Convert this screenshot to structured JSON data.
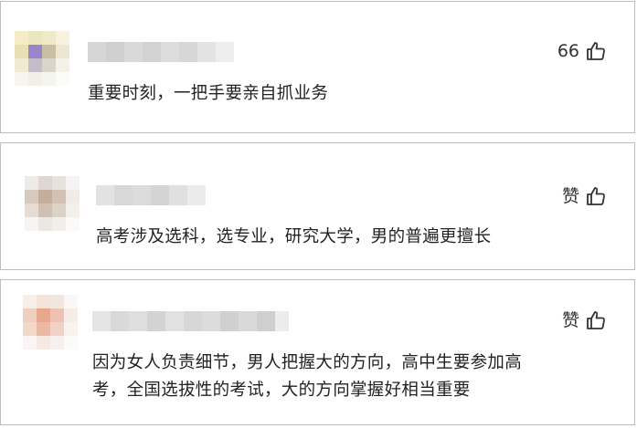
{
  "comments": [
    {
      "like_text": "66",
      "lines": [
        "重要时刻，一把手要亲自抓业务"
      ]
    },
    {
      "like_text": "赞",
      "lines": [
        "高考涉及选科，选专业，研究大学，男的普遍更擅长"
      ]
    },
    {
      "like_text": "赞",
      "lines": [
        "因为女人负责细节，男人把握大的方向，高中生要参加高",
        "考，全国选拔性的考试，大的方向掌握好相当重要"
      ]
    }
  ],
  "icons": {
    "like": "thumbs-up-icon"
  },
  "colors": {
    "border": "#bdbdbd",
    "text": "#222222"
  }
}
